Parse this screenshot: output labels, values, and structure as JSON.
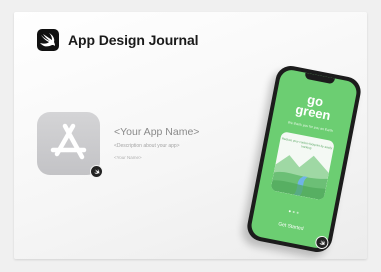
{
  "brand": {
    "title": "App Design Journal",
    "logo_icon": "swift-bird-icon"
  },
  "app": {
    "name": "<Your App Name>",
    "description": "<Description about your app>",
    "author": "<Your Name>",
    "icon": "app-store-icon",
    "badge_icon": "swift-badge-icon"
  },
  "phone": {
    "title": "go\ngreen",
    "subtitle": "We thank you for you an Earth",
    "card_text": "Reduce your carbon footprint by easily tracking",
    "cta": "Get Started",
    "accent": "#6cce72"
  }
}
